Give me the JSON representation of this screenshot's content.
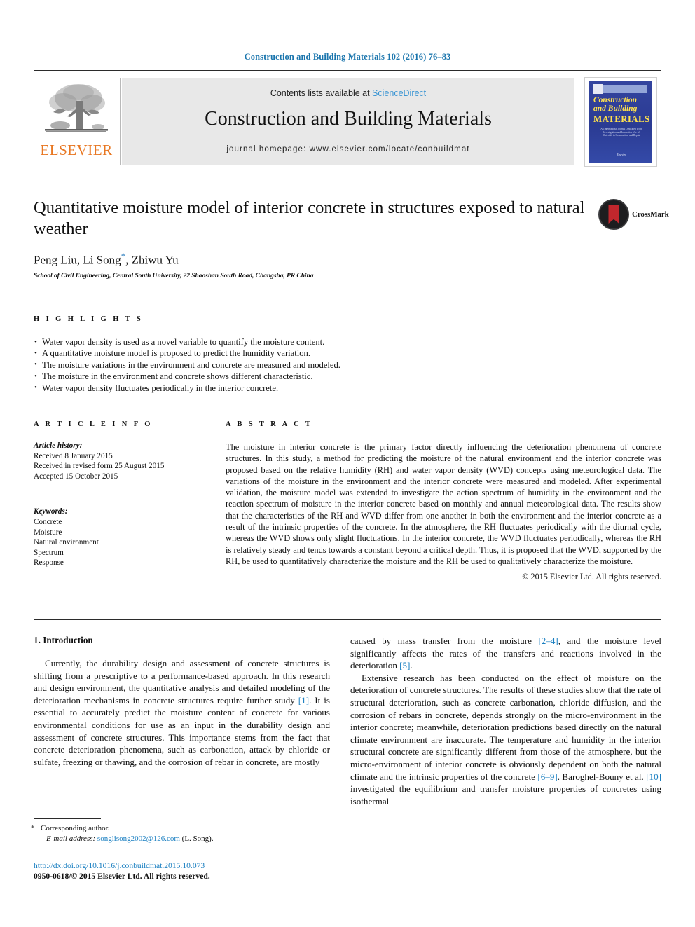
{
  "running_head": "Construction and Building Materials 102 (2016) 76–83",
  "masthead": {
    "elsevier_wordmark": "ELSEVIER",
    "contents_prefix": "Contents lists available at ",
    "contents_link": "ScienceDirect",
    "journal_title": "Construction and Building Materials",
    "journal_homepage": "journal homepage: www.elsevier.com/locate/conbuildmat",
    "cover": {
      "line1": "Construction",
      "line2": "and Building",
      "line3": "MATERIALS",
      "blurb": "An International Journal Dedicated to the Investigation and Innovative Use of Materials in Construction and Repair",
      "footer": "Elsevier"
    }
  },
  "article": {
    "title": "Quantitative moisture model of interior concrete in structures exposed to natural weather",
    "authors": "Peng Liu, Li Song",
    "authors_suffix": ", Zhiwu Yu",
    "corresponding_marker": "*",
    "affiliation": "School of Civil Engineering, Central South University, 22 Shaoshan South Road, Changsha, PR China",
    "crossmark_label": "CrossMark"
  },
  "highlights": {
    "label": "H I G H L I G H T S",
    "items": [
      "Water vapor density is used as a novel variable to quantify the moisture content.",
      "A quantitative moisture model is proposed to predict the humidity variation.",
      "The moisture variations in the environment and concrete are measured and modeled.",
      "The moisture in the environment and concrete shows different characteristic.",
      "Water vapor density fluctuates periodically in the interior concrete."
    ]
  },
  "article_info": {
    "label": "A R T I C L E   I N F O",
    "history_label": "Article history:",
    "received": "Received 8 January 2015",
    "revised": "Received in revised form 25 August 2015",
    "accepted": "Accepted 15 October 2015",
    "keywords_label": "Keywords:",
    "keywords": [
      "Concrete",
      "Moisture",
      "Natural environment",
      "Spectrum",
      "Response"
    ]
  },
  "abstract": {
    "label": "A B S T R A C T",
    "text": "The moisture in interior concrete is the primary factor directly influencing the deterioration phenomena of concrete structures. In this study, a method for predicting the moisture of the natural environment and the interior concrete was proposed based on the relative humidity (RH) and water vapor density (WVD) concepts using meteorological data. The variations of the moisture in the environment and the interior concrete were measured and modeled. After experimental validation, the moisture model was extended to investigate the action spectrum of humidity in the environment and the reaction spectrum of moisture in the interior concrete based on monthly and annual meteorological data. The results show that the characteristics of the RH and WVD differ from one another in both the environment and the interior concrete as a result of the intrinsic properties of the concrete. In the atmosphere, the RH fluctuates periodically with the diurnal cycle, whereas the WVD shows only slight fluctuations. In the interior concrete, the WVD fluctuates periodically, whereas the RH is relatively steady and tends towards a constant beyond a critical depth. Thus, it is proposed that the WVD, supported by the RH, be used to quantitatively characterize the moisture and the RH be used to qualitatively characterize the moisture.",
    "copyright": "© 2015 Elsevier Ltd. All rights reserved."
  },
  "body": {
    "section_heading": "1. Introduction",
    "left_para_1_a": "Currently, the durability design and assessment of concrete structures is shifting from a prescriptive to a performance-based approach. In this research and design environment, the quantitative analysis and detailed modeling of the deterioration mechanisms in concrete structures require further study ",
    "left_ref_1": "[1]",
    "left_para_1_b": ". It is essential to accurately predict the moisture content of concrete for various environmental conditions for use as an input in the durability design and assessment of concrete structures. This importance stems from the fact that concrete deterioration phenomena, such as carbonation, attack by chloride or sulfate, freezing or thawing, and the corrosion of rebar in concrete, are mostly",
    "right_para_1_a": "caused by mass transfer from the moisture ",
    "right_ref_1": "[2–4]",
    "right_para_1_b": ", and the moisture level significantly affects the rates of the transfers and reactions involved in the deterioration ",
    "right_ref_2": "[5]",
    "right_para_1_c": ".",
    "right_para_2_a": "Extensive research has been conducted on the effect of moisture on the deterioration of concrete structures. The results of these studies show that the rate of structural deterioration, such as concrete carbonation, chloride diffusion, and the corrosion of rebars in concrete, depends strongly on the micro-environment in the interior concrete; meanwhile, deterioration predictions based directly on the natural climate environment are inaccurate. The temperature and humidity in the interior structural concrete are significantly different from those of the atmosphere, but the micro-environment of interior concrete is obviously dependent on both the natural climate and the intrinsic properties of the concrete ",
    "right_ref_3": "[6–9]",
    "right_para_2_b": ". Baroghel-Bouny et al. ",
    "right_ref_4": "[10]",
    "right_para_2_c": " investigated the equilibrium and transfer moisture properties of concretes using isothermal"
  },
  "footnotes": {
    "corresponding": "Corresponding author.",
    "email_label": "E-mail address:",
    "email": "songlisong2002@126.com",
    "email_suffix": "(L. Song).",
    "doi": "http://dx.doi.org/10.1016/j.conbuildmat.2015.10.073",
    "issn": "0950-0618/© 2015 Elsevier Ltd. All rights reserved."
  }
}
